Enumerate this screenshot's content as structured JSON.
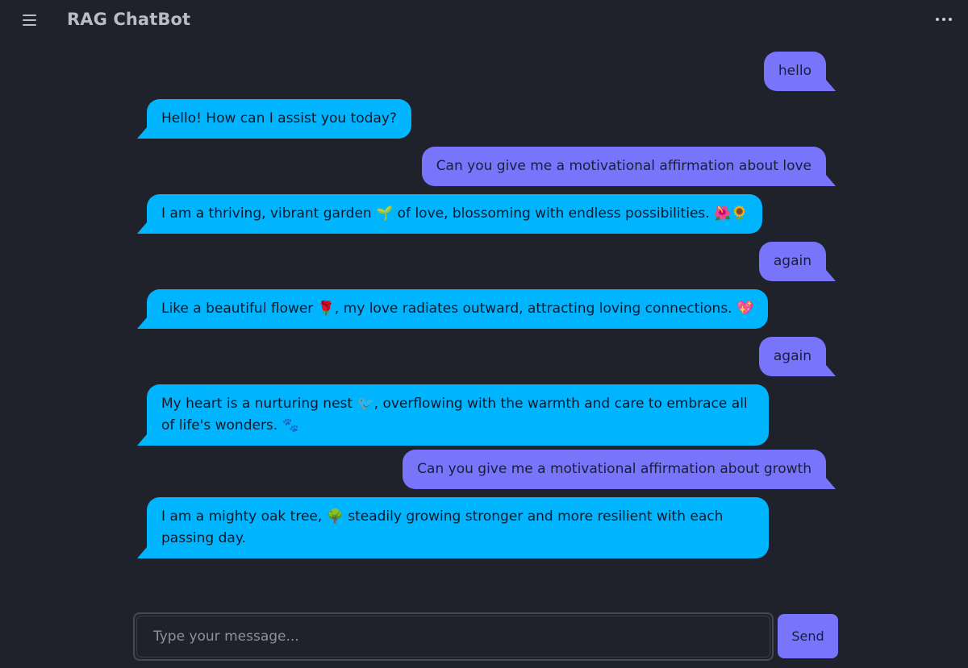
{
  "header": {
    "title": "RAG ChatBot",
    "menu_icon": "hamburger-menu-icon",
    "more_icon": "more-options-icon"
  },
  "messages": [
    {
      "role": "user",
      "text": "hello"
    },
    {
      "role": "bot",
      "text": "Hello! How can I assist you today?"
    },
    {
      "role": "user",
      "text": "Can you give me a motivational affirmation about love"
    },
    {
      "role": "bot",
      "text": "I am a thriving, vibrant garden 🌱 of love, blossoming with endless possibilities. 🌺🌻"
    },
    {
      "role": "user",
      "text": "again"
    },
    {
      "role": "bot",
      "text": "Like a beautiful flower 🌹, my love radiates outward, attracting loving connections. 💖"
    },
    {
      "role": "user",
      "text": "again"
    },
    {
      "role": "bot",
      "text": "My heart is a nurturing nest 🐦, overflowing with the warmth and care to embrace all of life's wonders. 🐾"
    },
    {
      "role": "user",
      "text": "Can you give me a motivational affirmation about growth"
    },
    {
      "role": "bot",
      "text": "I am a mighty oak tree, 🌳 steadily growing stronger and more resilient with each passing day."
    }
  ],
  "composer": {
    "placeholder": "Type your message...",
    "value": "",
    "send_label": "Send"
  },
  "colors": {
    "background": "#1f222a",
    "user_bubble": "#7875fb",
    "bot_bubble": "#00b4fe"
  }
}
